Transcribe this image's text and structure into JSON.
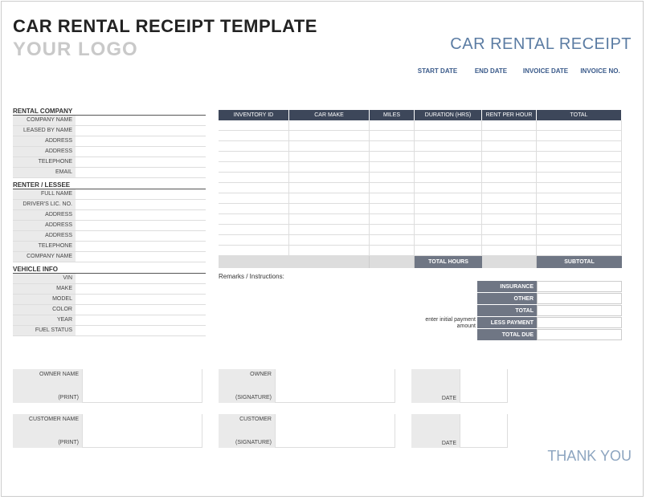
{
  "title": "CAR RENTAL RECEIPT TEMPLATE",
  "logo": "YOUR LOGO",
  "header_right": "CAR RENTAL RECEIPT",
  "dates": {
    "start": "START DATE",
    "end": "END DATE",
    "invoice_date": "INVOICE DATE",
    "invoice_no": "INVOICE NO."
  },
  "sections": {
    "rental_company": {
      "header": "RENTAL COMPANY",
      "fields": [
        "COMPANY NAME",
        "LEASED BY NAME",
        "ADDRESS",
        "ADDRESS",
        "TELEPHONE",
        "EMAIL"
      ]
    },
    "renter": {
      "header": "RENTER / LESSEE",
      "fields": [
        "FULL NAME",
        "DRIVER'S LIC. NO.",
        "ADDRESS",
        "ADDRESS",
        "ADDRESS",
        "TELEPHONE",
        "COMPANY NAME"
      ]
    },
    "vehicle": {
      "header": "VEHICLE INFO",
      "fields": [
        "VIN",
        "MAKE",
        "MODEL",
        "COLOR",
        "YEAR",
        "FUEL STATUS"
      ]
    }
  },
  "table": {
    "headers": [
      "INVENTORY ID",
      "CAR MAKE",
      "MILES",
      "DURATION (HRS)",
      "RENT PER HOUR",
      "TOTAL"
    ],
    "row_count": 13
  },
  "totals": {
    "total_hours": "TOTAL HOURS",
    "subtotal": "SUBTOTAL",
    "insurance": "INSURANCE",
    "other": "OTHER",
    "total": "TOTAL",
    "less_payment": "LESS PAYMENT",
    "total_due": "TOTAL DUE",
    "payment_note": "enter initial payment amount"
  },
  "remarks": "Remarks / Instructions:",
  "signatures": {
    "owner_name": "OWNER NAME",
    "print": "(PRINT)",
    "owner": "OWNER",
    "signature": "(SIGNATURE)",
    "date": "DATE",
    "customer_name": "CUSTOMER NAME",
    "customer": "CUSTOMER"
  },
  "thank_you": "THANK YOU"
}
